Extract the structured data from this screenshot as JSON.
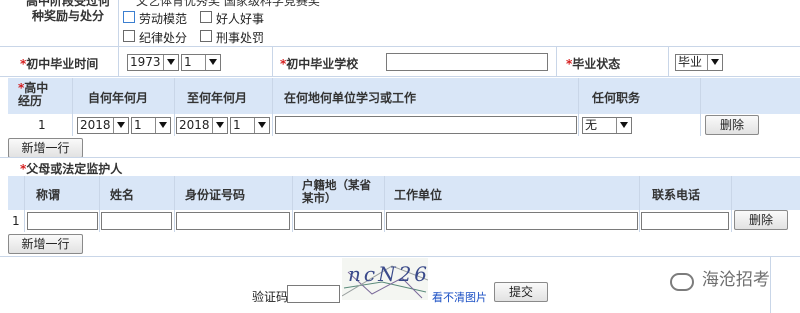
{
  "top_section": {
    "label_line1": "高中阶段受过何",
    "label_line2": "种奖励与处分",
    "row0_text": "文艺体育优秀奖   国家级科学竞赛奖",
    "checkboxes": [
      {
        "label": "劳动模范",
        "checked": false
      },
      {
        "label": "好人好事",
        "checked": false
      },
      {
        "label": "纪律处分",
        "checked": false
      },
      {
        "label": "刑事处罚",
        "checked": false
      }
    ]
  },
  "junior_grad": {
    "time_label": "初中毕业时间",
    "year_value": "1973",
    "month_value": "1",
    "school_label": "初中毕业学校",
    "school_value": "",
    "status_label": "毕业状态",
    "status_value": "毕业"
  },
  "experience": {
    "headers": [
      "高中经历",
      "自何年何月",
      "至何年何月",
      "在何地何单位学习或工作",
      "任何职务"
    ],
    "rows": [
      {
        "index": "1",
        "from_year": "2018",
        "from_month": "1",
        "to_year": "2018",
        "to_month": "1",
        "place": "",
        "position": "无",
        "delete_label": "删除"
      }
    ],
    "add_row_label": "新增一行"
  },
  "guardian": {
    "section_title": "父母或法定监护人",
    "headers": [
      "称谓",
      "姓名",
      "身份证号码",
      "户籍地（某省某市）",
      "工作单位",
      "联系电话"
    ],
    "rows": [
      {
        "index": "1",
        "title": "",
        "name": "",
        "id": "",
        "hukou": "",
        "employer": "",
        "phone": "",
        "delete_label": "删除"
      }
    ],
    "add_row_label": "新增一行"
  },
  "captcha": {
    "label": "验证码",
    "value": "",
    "image_text": "ncN26",
    "refresh_label": "看不清图片",
    "submit_label": "提交"
  },
  "watermark": {
    "text": "海沧招考"
  },
  "colors": {
    "header_bg": "#d9e6f7",
    "required": "#d00000",
    "link": "#1a4fc4"
  }
}
